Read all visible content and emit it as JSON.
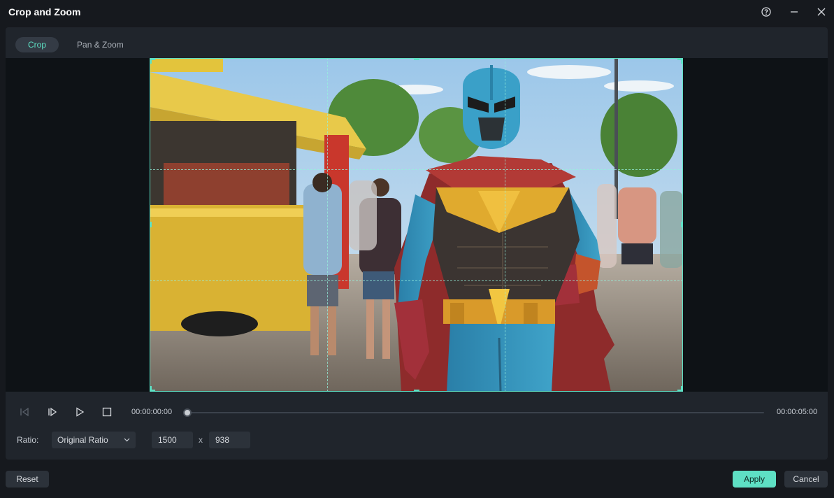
{
  "window": {
    "title": "Crop and Zoom",
    "help_icon": "help-circle-icon",
    "minimize_icon": "minimize-icon",
    "close_icon": "close-icon"
  },
  "tabs": [
    {
      "label": "Crop",
      "active": true
    },
    {
      "label": "Pan & Zoom",
      "active": false
    }
  ],
  "playback": {
    "current_time": "00:00:00:00",
    "total_time": "00:00:05:00",
    "progress": 0
  },
  "ratio": {
    "label": "Ratio:",
    "selected": "Original Ratio",
    "width": "1500",
    "height": "938",
    "separator": "x"
  },
  "buttons": {
    "reset": "Reset",
    "apply": "Apply",
    "cancel": "Cancel"
  },
  "colors": {
    "accent": "#5ee0c4",
    "background": "#16191e",
    "panel": "#20252c"
  }
}
